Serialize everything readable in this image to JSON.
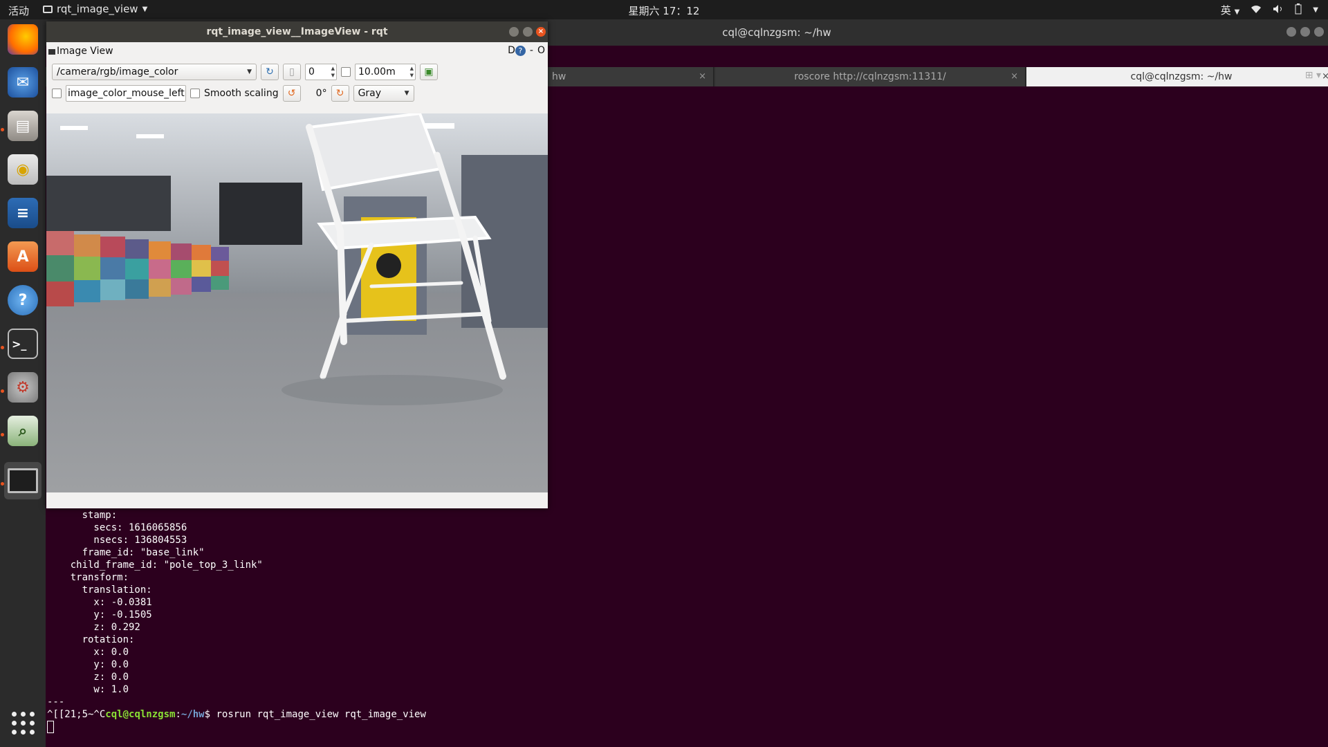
{
  "topbar": {
    "activities": "活动",
    "app_menu": "rqt_image_view",
    "clock": "星期六 17：12",
    "input_method": "英"
  },
  "dock": {
    "items": [
      "firefox-icon",
      "thunderbird-icon",
      "files-icon",
      "rhythmbox-icon",
      "libreoffice-writer-icon",
      "software-center-icon",
      "help-icon",
      "terminal-icon",
      "settings-icon",
      "image-viewer-icon",
      "rqt-window-icon"
    ]
  },
  "terminal": {
    "title": "cql@cqlnzgsm: ~/hw",
    "tabs": [
      {
        "label": "hw"
      },
      {
        "label": "roscore http://cqlnzgsm:11311/"
      },
      {
        "label": "cql@cqlnzgsm: ~/hw"
      }
    ],
    "lines": [
      "      stamp:",
      "        secs: 1616065856",
      "        nsecs: 136804553",
      "      frame_id: \"base_link\"",
      "    child_frame_id: \"pole_top_3_link\"",
      "    transform:",
      "      translation:",
      "        x: -0.0381",
      "        y: -0.1505",
      "        z: 0.292",
      "      rotation:",
      "        x: 0.0",
      "        y: 0.0",
      "        z: 0.0",
      "        w: 1.0",
      "---"
    ],
    "prompt_prefix": "^[[21;5~^C",
    "prompt_user": "cql@cqlnzgsm",
    "prompt_sep": ":",
    "prompt_path": "~/hw",
    "prompt_dollar": "$ ",
    "command": "rosrun rqt_image_view rqt_image_view"
  },
  "rqt": {
    "title": "rqt_image_view__ImageView - rqt",
    "plugin_name": "Image View",
    "plugin_right": "D",
    "plugin_dash": "-",
    "plugin_o": "O",
    "topic": "/camera/rgb/image_color",
    "spin_value": "0",
    "max_range": "10.00m",
    "mouse_topic": "image_color_mouse_left",
    "smooth_label": "Smooth scaling",
    "rotation": "0°",
    "color_scheme": "Gray",
    "tooltip": "rqt_image_view"
  }
}
